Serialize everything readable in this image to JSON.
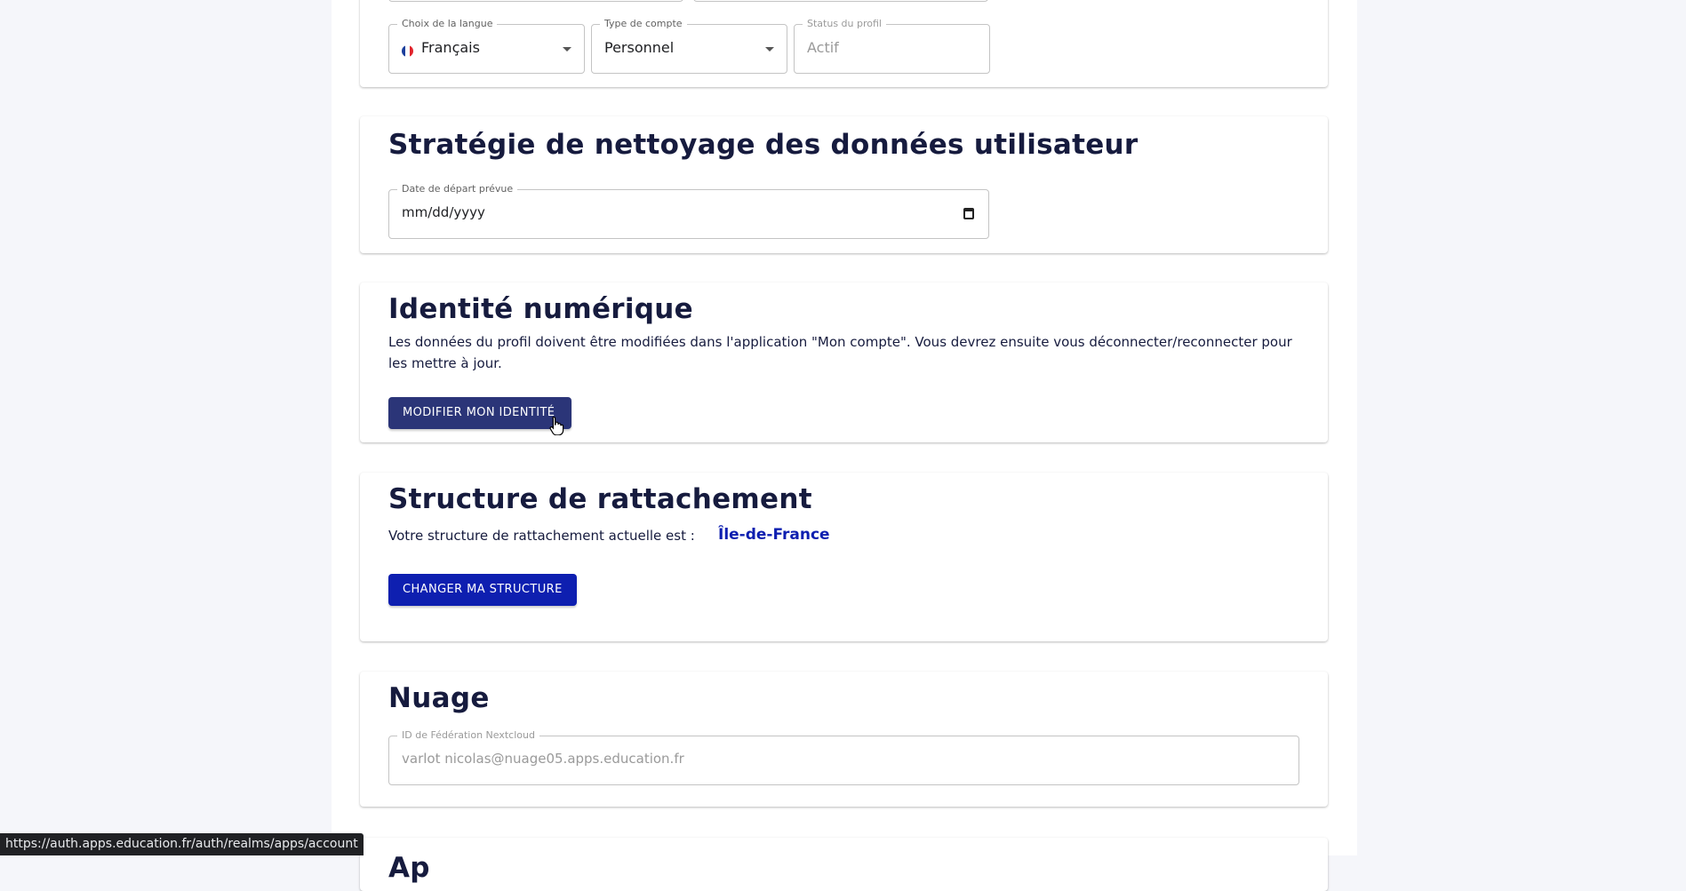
{
  "profile": {
    "language": {
      "legend": "Choix de la langue",
      "value": "Français",
      "flag_icon": "france-flag-icon"
    },
    "account_type": {
      "legend": "Type de compte",
      "value": "Personnel"
    },
    "status": {
      "legend": "Status du profil",
      "value": "Actif"
    }
  },
  "cleanup": {
    "title": "Stratégie de nettoyage des données utilisateur",
    "departure_date": {
      "legend": "Date de départ prévue",
      "value": "mm/dd/yyyy",
      "icon": "calendar-icon"
    }
  },
  "identity": {
    "title": "Identité numérique",
    "description": "Les données du profil doivent être modifiées dans l'application \"Mon compte\". Vous devrez ensuite vous déconnecter/reconnecter pour les mettre à jour.",
    "button_label": "MODIFIER MON IDENTITÉ"
  },
  "structure": {
    "title": "Structure de rattachement",
    "text": "Votre structure de rattachement actuelle est :",
    "current": "Île-de-France",
    "button_label": "CHANGER MA STRUCTURE"
  },
  "cloud": {
    "title": "Nuage",
    "federation_id": {
      "legend": "ID de Fédération Nextcloud",
      "value": "varlot nicolas@nuage05.apps.education.fr"
    }
  },
  "next_section": {
    "title": "Ap"
  },
  "status_bar": {
    "url": "https://auth.apps.education.fr/auth/realms/apps/account"
  },
  "colors": {
    "primary_button": "#2734a0",
    "primary_button_hover": "#2b3578",
    "accent_link": "#0e1fb0",
    "heading": "#161b3e"
  }
}
